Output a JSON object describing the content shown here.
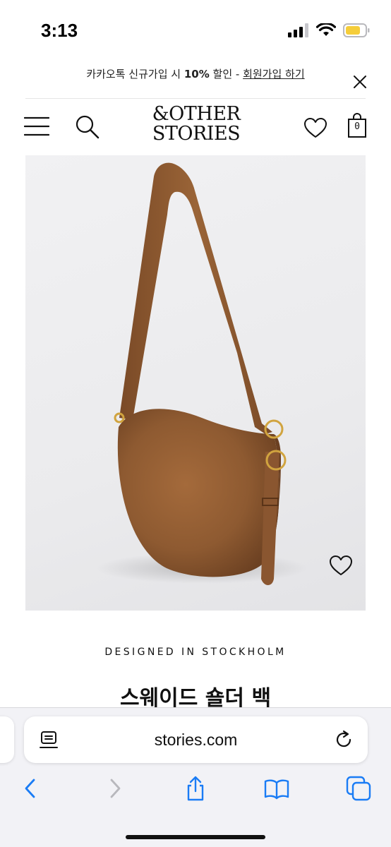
{
  "status_bar": {
    "time": "3:13",
    "icons": [
      "cellular-signal-icon",
      "wifi-icon",
      "battery-icon"
    ]
  },
  "promo": {
    "text_before": "카카오톡 신규가입 시 ",
    "discount": "10%",
    "text_middle": " 할인 - ",
    "link": "회원가입 하기",
    "close_icon": "close-icon"
  },
  "header": {
    "logo_line1": "&OTHER",
    "logo_line2": "STORIES",
    "bag_count": "0",
    "icons": [
      "menu-icon",
      "search-icon",
      "heart-icon",
      "bag-icon"
    ]
  },
  "product": {
    "image_description_icon": "suede-shoulder-bag-image",
    "tagline": "DESIGNED IN STOCKHOLM",
    "title": "스웨이드 숄더 백",
    "fav_icon": "heart-icon"
  },
  "browser": {
    "url": "stories.com",
    "icons": [
      "reader-icon",
      "reload-icon",
      "back-icon",
      "forward-icon",
      "share-icon",
      "bookmarks-icon",
      "tabs-icon"
    ]
  },
  "colors": {
    "ios_blue": "#1a7cf5",
    "disabled_gray": "#b8b8bd",
    "bag_brown": "#8e5a31",
    "battery_yellow": "#f5cd3a"
  }
}
